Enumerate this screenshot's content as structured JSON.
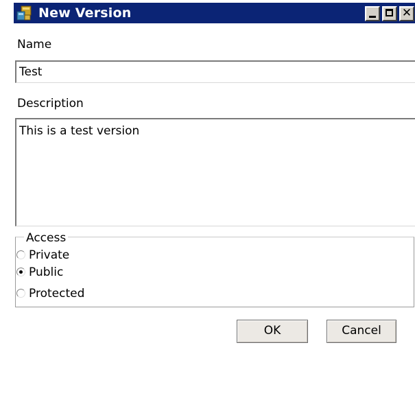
{
  "window": {
    "title": "New Version",
    "icon": "version-package-icon",
    "titlebar_color": "#0b2475",
    "controls": {
      "minimize_icon": "minimize-icon",
      "maximize_icon": "maximize-icon",
      "close_icon": "close-icon",
      "close_glyph": "✕"
    }
  },
  "form": {
    "name_label": "Name",
    "name_value": "Test",
    "description_label": "Description",
    "description_value": "This is a test version",
    "access": {
      "legend": "Access",
      "options": [
        {
          "label": "Private",
          "selected": false
        },
        {
          "label": "Public",
          "selected": true
        },
        {
          "label": "Protected",
          "selected": false
        }
      ]
    }
  },
  "buttons": {
    "ok_label": "OK",
    "cancel_label": "Cancel"
  }
}
